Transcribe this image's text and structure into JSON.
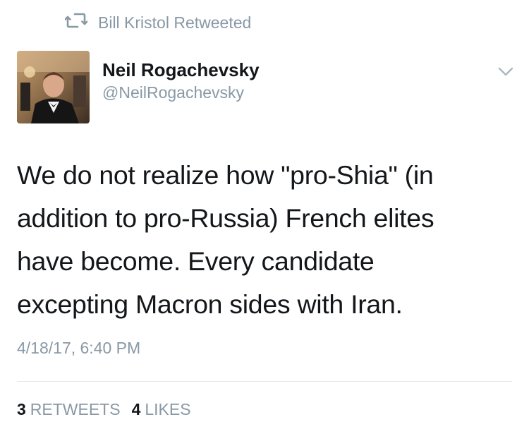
{
  "retweet_context": {
    "icon": "retweet-icon",
    "text": "Bill Kristol Retweeted"
  },
  "author": {
    "avatar": "avatar",
    "name": "Neil Rogachevsky",
    "handle": "@NeilRogachevsky"
  },
  "menu": {
    "icon": "chevron-down-icon"
  },
  "tweet": {
    "lines": [
      "We do not realize how \"pro-Shia\" (in",
      "addition to pro-Russia) French elites",
      "have become. Every candidate",
      "excepting Macron sides with Iran."
    ],
    "timestamp": "4/18/17, 6:40 PM"
  },
  "stats": {
    "retweets_count": "3",
    "retweets_label": "RETWEETS",
    "likes_count": "4",
    "likes_label": "LIKES"
  },
  "colors": {
    "text_primary": "#14171a",
    "text_secondary": "#8899a6",
    "divider": "#e1e8ed"
  }
}
